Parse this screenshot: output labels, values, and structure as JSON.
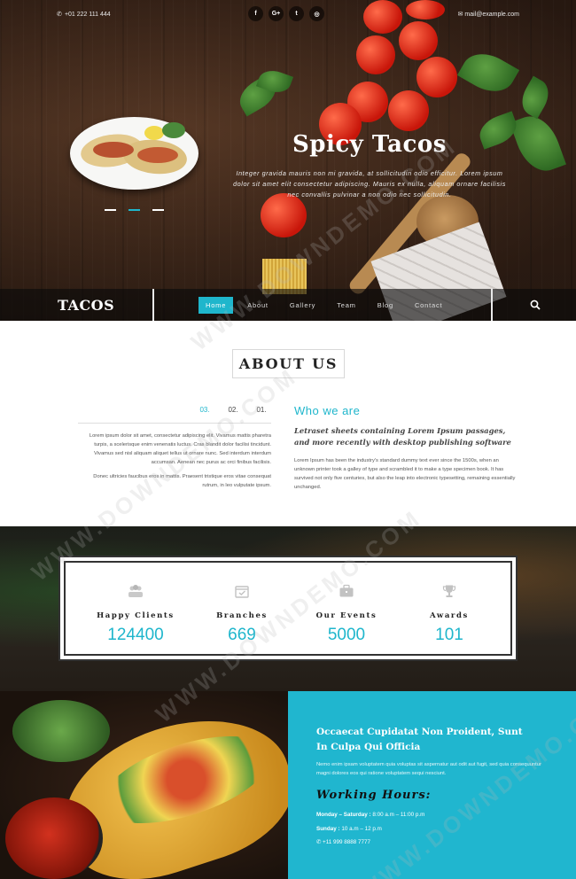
{
  "topbar": {
    "phone": "+01 222 111 444",
    "email": "mail@example.com",
    "social": [
      "f",
      "G+",
      "t",
      "◎"
    ]
  },
  "hero": {
    "title": "Spicy Tacos",
    "text": "Integer gravida mauris non mi gravida, at sollicitudin odio efficitur. Lorem ipsum dolor sit amet elit consectetur adipiscing. Mauris ex nulla, aliquam ornare facilisis nec convallis pulvinar a non odio nec sollicitudin."
  },
  "nav": {
    "logo": "TACOS",
    "items": [
      "Home",
      "About",
      "Gallery",
      "Team",
      "Blog",
      "Contact"
    ],
    "active": "Home"
  },
  "about": {
    "title": "ABOUT US",
    "tabs": [
      "03.",
      "02.",
      "01."
    ],
    "left_p1": "Lorem ipsum dolor sit amet, consectetur adipiscing elit. Vivamus mattis pharetra turpis, a scelerisque enim venenatis luctus. Cras blandit dolor facilisi tincidunt. Vivamus sed nisl aliquam aliquet tellus ut ornare nunc. Sed interdum interdum accumsan. Aenean nec purus ac orci finibus facilisis.",
    "left_p2": "Donec ultricies faucibus eros in mattis. Praesent tristique eros vitae consequat rutrum, in leo vulputate ipsum.",
    "who_title": "Who we are",
    "who_sub": "Letraset sheets containing Lorem Ipsum passages, and more recently with desktop publishing software",
    "who_body": "Lorem Ipsum has been the industry's standard dummy text ever since the 1500s, when an unknown printer took a galley of type and scrambled it to make a type specimen book. It has survived not only five centuries, but also the leap into electronic typesetting, remaining essentially unchanged."
  },
  "stats": [
    {
      "label": "Happy Clients",
      "value": "124400",
      "icon": "users-icon"
    },
    {
      "label": "Branches",
      "value": "669",
      "icon": "calendar-check-icon"
    },
    {
      "label": "Our Events",
      "value": "5000",
      "icon": "briefcase-icon"
    },
    {
      "label": "Awards",
      "value": "101",
      "icon": "trophy-icon"
    }
  ],
  "info": {
    "heading": "Occaecat Cupidatat Non Proident, Sunt In Culpa Qui Officia",
    "desc": "Nemo enim ipsam voluptatem quia voluptas sit aspernatur aut odit aut fugit, sed quia consequuntur magni dolores eos qui ratione voluptatem sequi nesciunt.",
    "hours_title": "Working Hours:",
    "row1_label": "Monday – Saturday :",
    "row1_value": "8:00 a.m – 11:00 p.m",
    "row2_label": "Sunday :",
    "row2_value": "10 a.m – 12 p.m",
    "phone": "+11 999 8888 7777"
  },
  "watermark": "WWW.DOWNDEMO.COM",
  "colors": {
    "accent": "#1fb6cc",
    "info_bg": "#20b6cf"
  }
}
